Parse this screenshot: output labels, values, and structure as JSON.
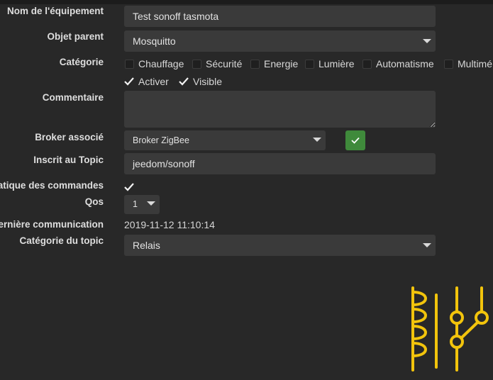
{
  "labels": {
    "nom": "Nom de l'équipement",
    "objet": "Objet parent",
    "categorie": "Catégorie",
    "commentaire": "Commentaire",
    "broker": "Broker associé",
    "topic": "Inscrit au Topic",
    "auto": "atique des commandes",
    "qos": "Qos",
    "last_comm": "ernière communication",
    "topic_cat": "Catégorie du topic"
  },
  "fields": {
    "nom_value": "Test sonoff tasmota",
    "objet_value": "Mosquitto",
    "broker_value": "Broker ZigBee",
    "topic_value": "jeedom/sonoff",
    "qos_value": "1",
    "last_comm_value": "2019-11-12 11:10:14",
    "topic_cat_value": "Relais",
    "comment_value": ""
  },
  "categories": [
    {
      "label": "Chauffage",
      "checked": false
    },
    {
      "label": "Sécurité",
      "checked": false
    },
    {
      "label": "Energie",
      "checked": false
    },
    {
      "label": "Lumière",
      "checked": false
    },
    {
      "label": "Automatisme",
      "checked": false
    },
    {
      "label": "Multimé",
      "checked": false
    }
  ],
  "options": {
    "activer": "Activer",
    "visible": "Visible"
  },
  "icons": {
    "relay": "relay-icon",
    "check": "check-icon"
  },
  "colors": {
    "background": "#282828",
    "field": "#3a3a3a",
    "accent_yellow": "#f2c40c",
    "ok_green": "#3f8a3b"
  }
}
